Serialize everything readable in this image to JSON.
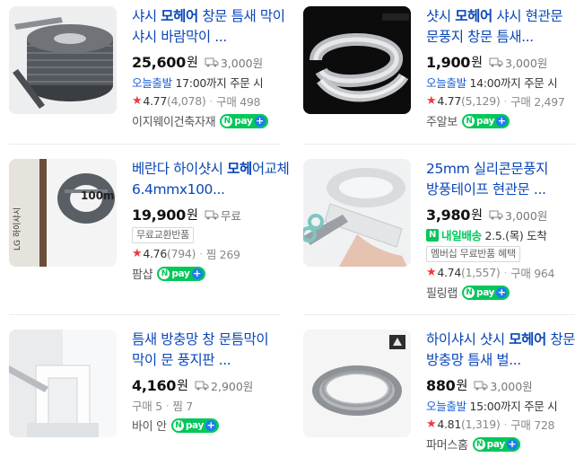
{
  "products": [
    {
      "title_pre": "샤시 ",
      "title_bold": "모헤어",
      "title_post": " 창문 틈새 막이 샤시 바람막이 ...",
      "price": "25,600",
      "currency": "원",
      "shipping": "3,000원",
      "dispatch_label": "오늘출발",
      "dispatch_text": "17:00까지 주문 시",
      "rating": "4.77",
      "reviews": "(4,078)",
      "purchase": "구매 498",
      "seller": "이지웨이건축자재",
      "npay": "pay"
    },
    {
      "title_pre": "샷시 ",
      "title_bold": "모헤어",
      "title_post": " 샤시 현관문 문풍지 창문 틈새...",
      "price": "1,900",
      "currency": "원",
      "shipping": "3,000원",
      "dispatch_label": "오늘출발",
      "dispatch_text": "14:00까지 주문 시",
      "rating": "4.77",
      "reviews": "(5,129)",
      "purchase": "구매 2,497",
      "seller": "주알보",
      "npay": "pay"
    },
    {
      "title_pre": "베란다 하이샷시 ",
      "title_bold": "모헤",
      "title_post": "어교체 6.4mmx100...",
      "price": "19,900",
      "currency": "원",
      "shipping": "무료",
      "tag": "무료교환반품",
      "rating": "4.76",
      "reviews": "(794)",
      "purchase": "찜 269",
      "seller": "팜샵",
      "npay": "pay",
      "thumb_label": "100m"
    },
    {
      "title_pre": "25mm 실리콘문풍지 방풍테이프 현관문 ...",
      "title_bold": "",
      "title_post": "",
      "price": "3,980",
      "currency": "원",
      "shipping": "3,000원",
      "arrive_label": "내일배송",
      "arrive_text": "2.5.(목) 도착",
      "tag": "멤버십 무료반품 혜택",
      "rating": "4.74",
      "reviews": "(1,557)",
      "purchase": "구매 964",
      "seller": "필링랩",
      "npay": "pay"
    },
    {
      "title_pre": "틈새 방충망 창 문틈막이 막이 문 풍지판 ...",
      "title_bold": "",
      "title_post": "",
      "price": "4,160",
      "currency": "원",
      "shipping": "2,900원",
      "purchase_line": "구매 5",
      "wish": "찜 7",
      "seller": "바이 안",
      "npay": "pay"
    },
    {
      "title_pre": "하이샤시 샷시 ",
      "title_bold": "모헤어",
      "title_post": " 창문 방충망 틈새 벌...",
      "price": "880",
      "currency": "원",
      "shipping": "3,000원",
      "dispatch_label": "오늘출발",
      "dispatch_text": "15:00까지 주문 시",
      "rating": "4.81",
      "reviews": "(1,319)",
      "purchase": "구매 728",
      "seller": "파머스홈",
      "npay": "pay"
    }
  ]
}
